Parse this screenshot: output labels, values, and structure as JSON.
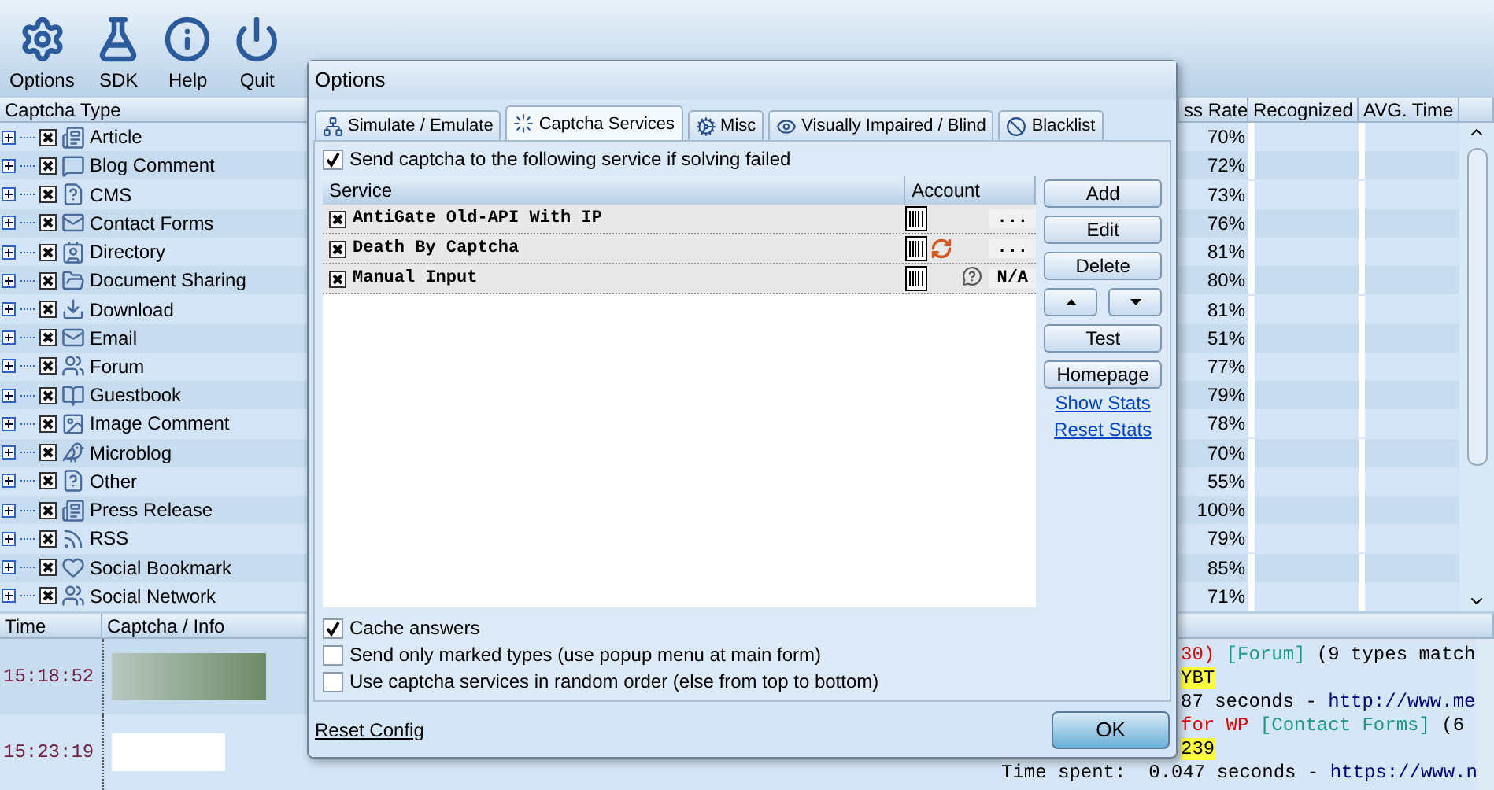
{
  "toolbar": [
    {
      "label": "Options"
    },
    {
      "label": "SDK"
    },
    {
      "label": "Help"
    },
    {
      "label": "Quit"
    }
  ],
  "captcha_table": {
    "columns": [
      "Captcha Type",
      "ss Rate",
      "Recognized",
      "AVG. Time"
    ],
    "rows": [
      {
        "name": "Article",
        "checked": true,
        "rate": "70%"
      },
      {
        "name": "Blog Comment",
        "checked": true,
        "rate": "72%"
      },
      {
        "name": "CMS",
        "checked": true,
        "rate": "73%"
      },
      {
        "name": "Contact Forms",
        "checked": true,
        "rate": "76%"
      },
      {
        "name": "Directory",
        "checked": true,
        "rate": "81%"
      },
      {
        "name": "Document Sharing",
        "checked": true,
        "rate": "80%"
      },
      {
        "name": "Download",
        "checked": true,
        "rate": "81%"
      },
      {
        "name": "Email",
        "checked": true,
        "rate": "51%"
      },
      {
        "name": "Forum",
        "checked": true,
        "rate": "77%"
      },
      {
        "name": "Guestbook",
        "checked": true,
        "rate": "79%"
      },
      {
        "name": "Image Comment",
        "checked": true,
        "rate": "78%"
      },
      {
        "name": "Microblog",
        "checked": true,
        "rate": "70%"
      },
      {
        "name": "Other",
        "checked": true,
        "rate": "55%"
      },
      {
        "name": "Press Release",
        "checked": true,
        "rate": "100%"
      },
      {
        "name": "RSS",
        "checked": true,
        "rate": "79%"
      },
      {
        "name": "Social Bookmark",
        "checked": true,
        "rate": "85%"
      },
      {
        "name": "Social Network",
        "checked": true,
        "rate": "71%"
      }
    ]
  },
  "history": {
    "columns": [
      "Time",
      "Captcha / Info"
    ],
    "rows": [
      {
        "time": "15:18:52"
      },
      {
        "time": "15:23:19"
      }
    ]
  },
  "log": {
    "lines": [
      {
        "segments": [
          {
            "kind": "error",
            "text": "30)"
          },
          {
            "kind": "tag",
            "text": " [Forum]"
          },
          {
            "kind": "plain",
            "text": " (9 types match"
          }
        ]
      },
      {
        "segments": [
          {
            "kind": "answer",
            "text": "YBT"
          }
        ]
      },
      {
        "segments": [
          {
            "kind": "plain",
            "text": "87 seconds - "
          },
          {
            "kind": "url",
            "text": "http://www.me"
          }
        ]
      },
      {
        "segments": [
          {
            "kind": "error",
            "text": "for WP"
          },
          {
            "kind": "tag",
            "text": " [Contact Forms]"
          },
          {
            "kind": "plain",
            "text": " (6"
          }
        ]
      },
      {
        "segments": [
          {
            "kind": "answer",
            "text": "239"
          }
        ]
      },
      {
        "segments": [
          {
            "kind": "plain",
            "text": "Time spent:  0.047 seconds - "
          },
          {
            "kind": "url",
            "text": "https://www.n"
          }
        ]
      }
    ]
  },
  "dialog": {
    "title": "Options",
    "tabs": [
      {
        "label": "Simulate / Emulate",
        "selected": false
      },
      {
        "label": "Captcha Services",
        "selected": true
      },
      {
        "label": "Misc",
        "selected": false
      },
      {
        "label": "Visually Impaired / Blind",
        "selected": false
      },
      {
        "label": "Blacklist",
        "selected": false
      }
    ],
    "send_on_fail": {
      "label": "Send captcha to the following service if solving failed",
      "checked": true
    },
    "services": {
      "columns": [
        "Service",
        "Account"
      ],
      "rows": [
        {
          "name": "AntiGate Old-API With IP",
          "checked": true,
          "kind": "plain",
          "account": "..."
        },
        {
          "name": "Death By Captcha",
          "checked": true,
          "kind": "refresh",
          "account": "..."
        },
        {
          "name": "Manual Input",
          "checked": true,
          "kind": "manual",
          "account": "N/A"
        }
      ]
    },
    "buttons": [
      "Add",
      "Edit",
      "Delete"
    ],
    "buttons_2": [
      "Test",
      "Homepage"
    ],
    "links": [
      "Show Stats",
      "Reset Stats"
    ],
    "options": [
      {
        "label": "Cache answers",
        "checked": true
      },
      {
        "label": "Send only marked types (use popup menu at main form)",
        "checked": false
      },
      {
        "label": "Use captcha services in random order (else from top to bottom)",
        "checked": false
      }
    ],
    "reset_link": "Reset Config",
    "ok": "OK"
  }
}
